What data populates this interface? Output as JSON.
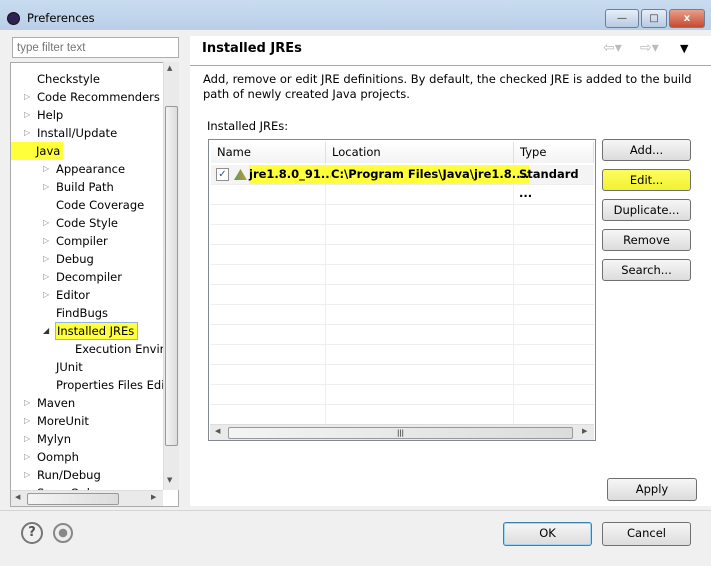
{
  "window": {
    "title": "Preferences"
  },
  "filter": {
    "placeholder": "type filter text"
  },
  "tree": [
    {
      "label": "Checkstyle",
      "level": 0,
      "arrow": ""
    },
    {
      "label": "Code Recommenders",
      "level": 0,
      "arrow": "collapsed"
    },
    {
      "label": "Help",
      "level": 0,
      "arrow": "collapsed"
    },
    {
      "label": "Install/Update",
      "level": 0,
      "arrow": "collapsed"
    },
    {
      "label": "Java",
      "level": 0,
      "arrow": "expanded",
      "highlight": true
    },
    {
      "label": "Appearance",
      "level": 1,
      "arrow": "collapsed"
    },
    {
      "label": "Build Path",
      "level": 1,
      "arrow": "collapsed"
    },
    {
      "label": "Code Coverage",
      "level": 1,
      "arrow": ""
    },
    {
      "label": "Code Style",
      "level": 1,
      "arrow": "collapsed"
    },
    {
      "label": "Compiler",
      "level": 1,
      "arrow": "collapsed"
    },
    {
      "label": "Debug",
      "level": 1,
      "arrow": "collapsed"
    },
    {
      "label": "Decompiler",
      "level": 1,
      "arrow": "collapsed"
    },
    {
      "label": "Editor",
      "level": 1,
      "arrow": "collapsed"
    },
    {
      "label": "FindBugs",
      "level": 1,
      "arrow": ""
    },
    {
      "label": "Installed JREs",
      "level": 1,
      "arrow": "expanded",
      "highlight": true,
      "selected": true
    },
    {
      "label": "Execution Enviro",
      "level": 2,
      "arrow": ""
    },
    {
      "label": "JUnit",
      "level": 1,
      "arrow": ""
    },
    {
      "label": "Properties Files Edito",
      "level": 1,
      "arrow": ""
    },
    {
      "label": "Maven",
      "level": 0,
      "arrow": "collapsed"
    },
    {
      "label": "MoreUnit",
      "level": 0,
      "arrow": "collapsed"
    },
    {
      "label": "Mylyn",
      "level": 0,
      "arrow": "collapsed"
    },
    {
      "label": "Oomph",
      "level": 0,
      "arrow": "collapsed"
    },
    {
      "label": "Run/Debug",
      "level": 0,
      "arrow": "collapsed"
    },
    {
      "label": "SonarQube",
      "level": 0,
      "arrow": "collapsed"
    }
  ],
  "page": {
    "title": "Installed JREs",
    "description": "Add, remove or edit JRE definitions. By default, the checked JRE is added to the build path of newly created Java projects.",
    "table_label": "Installed JREs:",
    "columns": [
      "Name",
      "Location",
      "Type"
    ],
    "rows": [
      {
        "checked": true,
        "name": "jre1.8.0_91...",
        "location": "C:\\Program Files\\Java\\jre1.8....",
        "type": "Standard ..."
      }
    ],
    "buttons": [
      "Add...",
      "Edit...",
      "Duplicate...",
      "Remove",
      "Search..."
    ],
    "apply": "Apply"
  },
  "footer": {
    "ok": "OK",
    "cancel": "Cancel"
  },
  "colors": {
    "highlight": "#ffff3b",
    "selection": "#dbeaf9"
  }
}
